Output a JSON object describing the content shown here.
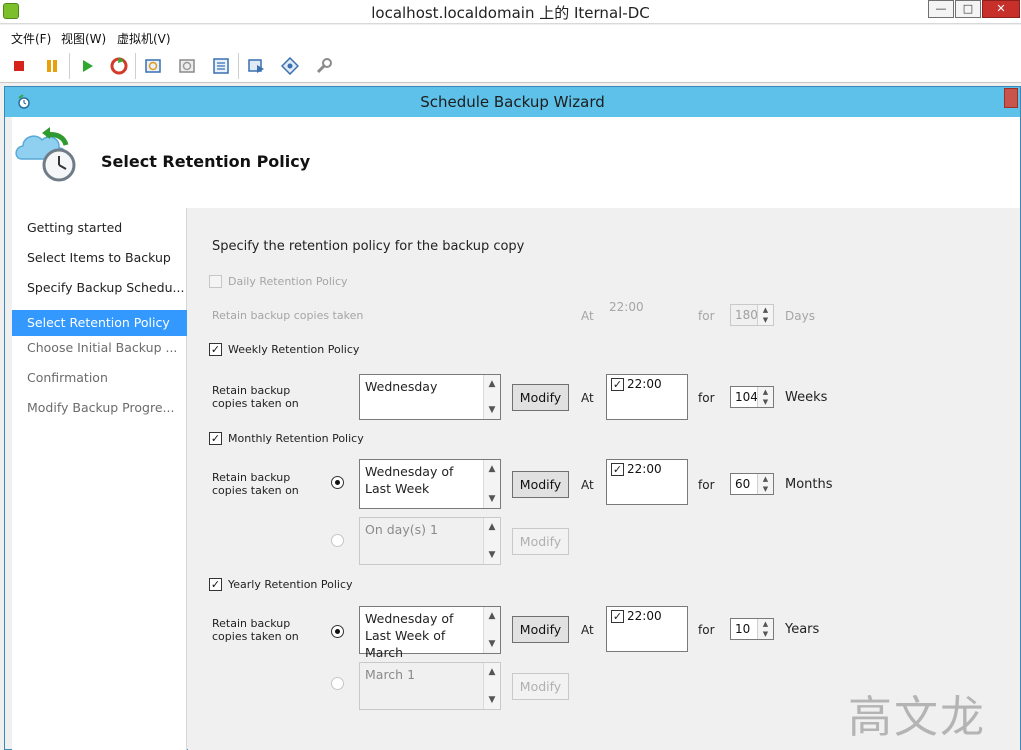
{
  "vm_window": {
    "title": "localhost.localdomain 上的 Iternal-DC",
    "controls": {
      "minimize": "—",
      "maximize": "□",
      "close": "✕"
    },
    "menu": [
      "文件(F)",
      "视图(W)",
      "虚拟机(V)"
    ],
    "toolbar_icons": [
      "stop-icon",
      "pause-icon",
      "play-icon",
      "reset-icon",
      "snapshot-icon",
      "revert-snapshot-icon",
      "manage-snapshots-icon",
      "console-settings-icon",
      "network-icon",
      "devices-icon"
    ]
  },
  "wizard": {
    "title": "Schedule Backup Wizard",
    "page_title": "Select Retention Policy",
    "nav": [
      {
        "label": "Getting started",
        "state": "done"
      },
      {
        "label": "Select Items to Backup",
        "state": "done"
      },
      {
        "label": "Specify Backup Schedu...",
        "state": "done"
      },
      {
        "label": "Select Retention Policy",
        "state": "active"
      },
      {
        "label": "Choose Initial Backup ...",
        "state": "todo"
      },
      {
        "label": "Confirmation",
        "state": "todo"
      },
      {
        "label": "Modify Backup Progre...",
        "state": "todo"
      }
    ],
    "intro": "Specify the retention policy for the backup copy",
    "daily": {
      "label": "Daily Retention Policy",
      "checked": false,
      "retain_label": "Retain backup copies taken",
      "at_label": "At",
      "time": "22:00",
      "for_label": "for",
      "count": "180",
      "unit": "Days"
    },
    "weekly": {
      "label": "Weekly Retention Policy",
      "checked": true,
      "retain_label_1": "Retain backup",
      "retain_label_2": "copies taken on",
      "day": "Wednesday",
      "modify": "Modify",
      "at_label": "At",
      "time": "22:00",
      "for_label": "for",
      "count": "104",
      "unit": "Weeks"
    },
    "monthly": {
      "label": "Monthly Retention Policy",
      "checked": true,
      "retain_label_1": "Retain backup",
      "retain_label_2": "copies taken on",
      "option1": "Wednesday of Last Week",
      "option2": "On day(s) 1",
      "modify": "Modify",
      "at_label": "At",
      "time": "22:00",
      "for_label": "for",
      "count": "60",
      "unit": "Months"
    },
    "yearly": {
      "label": "Yearly Retention Policy",
      "checked": true,
      "retain_label_1": "Retain backup",
      "retain_label_2": "copies taken on",
      "option1": "Wednesday of Last Week of March",
      "option2": "March 1",
      "modify": "Modify",
      "at_label": "At",
      "time": "22:00",
      "for_label": "for",
      "count": "10",
      "unit": "Years"
    },
    "scroll_up": "▲",
    "scroll_down": "▼",
    "check_mark": "✓"
  },
  "watermark": "高文龙",
  "colors": {
    "wizard_titlebar": "#5ec1e9",
    "nav_selected": "#3399ff",
    "close_red": "#c7302a"
  }
}
